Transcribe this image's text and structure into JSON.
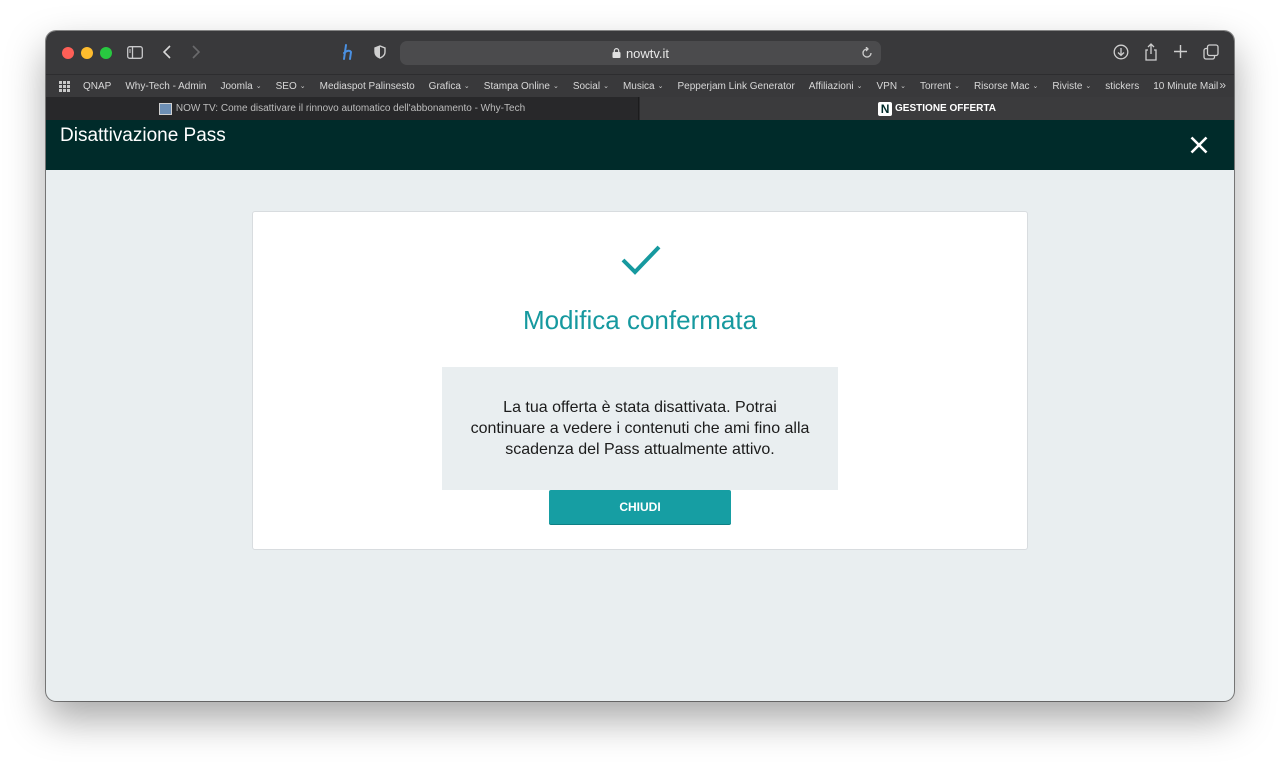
{
  "browser": {
    "address": "nowtv.it"
  },
  "bookmarks": [
    {
      "label": "QNAP",
      "menu": false
    },
    {
      "label": "Why-Tech - Admin",
      "menu": false
    },
    {
      "label": "Joomla",
      "menu": true
    },
    {
      "label": "SEO",
      "menu": true
    },
    {
      "label": "Mediaspot Palinsesto",
      "menu": false
    },
    {
      "label": "Grafica",
      "menu": true
    },
    {
      "label": "Stampa Online",
      "menu": true
    },
    {
      "label": "Social",
      "menu": true
    },
    {
      "label": "Musica",
      "menu": true
    },
    {
      "label": "Pepperjam Link Generator",
      "menu": false
    },
    {
      "label": "Affiliazioni",
      "menu": true
    },
    {
      "label": "VPN",
      "menu": true
    },
    {
      "label": "Torrent",
      "menu": true
    },
    {
      "label": "Risorse Mac",
      "menu": true
    },
    {
      "label": "Riviste",
      "menu": true
    },
    {
      "label": "stickers",
      "menu": false
    },
    {
      "label": "10 Minute Mail",
      "menu": false
    }
  ],
  "tabs": [
    {
      "title": "NOW TV: Come disattivare il rinnovo automatico dell'abbonamento - Why-Tech",
      "active": false
    },
    {
      "title": "GESTIONE OFFERTA",
      "active": true
    }
  ],
  "page": {
    "title": "Disattivazione Pass",
    "confirm_title": "Modifica confermata",
    "message": "La tua offerta è stata disattivata. Potrai continuare a vedere i contenuti che ami fino alla scadenza del Pass attualmente attivo.",
    "close_button": "CHIUDI"
  },
  "colors": {
    "header_bg": "#002b2a",
    "accent": "#16999f",
    "page_bg": "#e9eef0"
  }
}
